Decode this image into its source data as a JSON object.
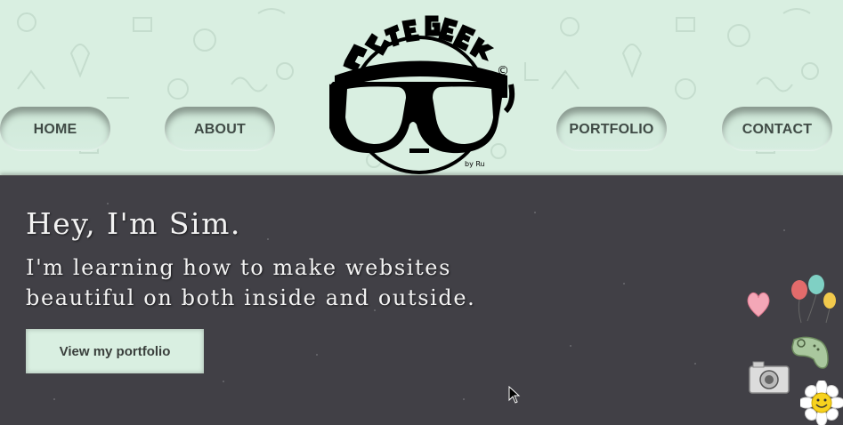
{
  "nav": {
    "items": [
      {
        "label": "HOME"
      },
      {
        "label": "ABOUT"
      },
      {
        "label": "PORTFOLIO"
      },
      {
        "label": "CONTACT"
      }
    ]
  },
  "logo": {
    "text": "CUTE GEEK",
    "byline": "by Ru",
    "copyright_symbol": "©"
  },
  "hero": {
    "title": "Hey, I'm Sim.",
    "subtitle_line1": "I'm learning how to make websites",
    "subtitle_line2": "beautiful on both inside and outside.",
    "cta_label": "View my portfolio"
  },
  "colors": {
    "header_bg": "#d9efe1",
    "hero_bg": "#414046",
    "nav_text": "#3f4a45"
  },
  "decorations": [
    "heart-sticker",
    "balloons-sticker",
    "game-controller-sticker",
    "camera-sticker",
    "daisy-smiley-sticker"
  ]
}
